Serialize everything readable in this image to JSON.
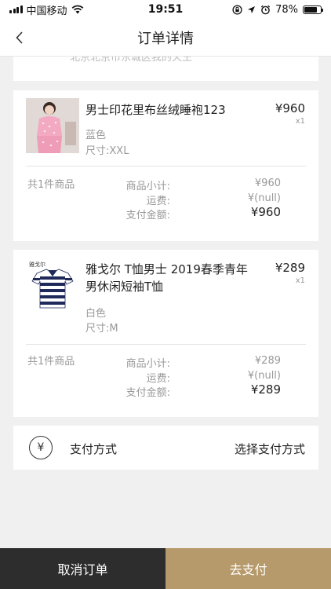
{
  "status_bar": {
    "carrier": "中国移动",
    "time": "19:51",
    "battery": "78%",
    "battery_level": 0.78,
    "icons": [
      "signal-icon",
      "wifi-icon",
      "lock-rotation-icon",
      "location-icon",
      "alarm-icon",
      "battery-icon"
    ]
  },
  "nav": {
    "title": "订单详情",
    "back_icon": "chevron-left-icon"
  },
  "partial_card": {
    "text": "北京北京市东城区我的天王"
  },
  "orders": [
    {
      "name": "男士印花里布丝绒睡袍123",
      "price": "¥960",
      "qty": "x1",
      "color": "蓝色",
      "size": "尺寸:XXL",
      "count": "共1件商品",
      "subtotal_label": "商品小计:",
      "subtotal": "¥960",
      "shipping_label": "运费:",
      "shipping": "¥(null)",
      "total_label": "支付金额:",
      "total": "¥960"
    },
    {
      "name": "雅戈尔 T恤男士 2019春季青年男休闲短袖T恤",
      "price": "¥289",
      "qty": "x1",
      "color": "白色",
      "size": "尺寸:M",
      "count": "共1件商品",
      "subtotal_label": "商品小计:",
      "subtotal": "¥289",
      "shipping_label": "运费:",
      "shipping": "¥(null)",
      "total_label": "支付金额:",
      "total": "¥289"
    }
  ],
  "payment": {
    "icon": "yen-icon",
    "label": "支付方式",
    "select": "选择支付方式"
  },
  "bottom": {
    "cancel": "取消订单",
    "pay": "去支付"
  },
  "colors": {
    "pay_button": "#b79a6b",
    "cancel_button": "#2d2d2d",
    "background": "#f0f0f0"
  }
}
